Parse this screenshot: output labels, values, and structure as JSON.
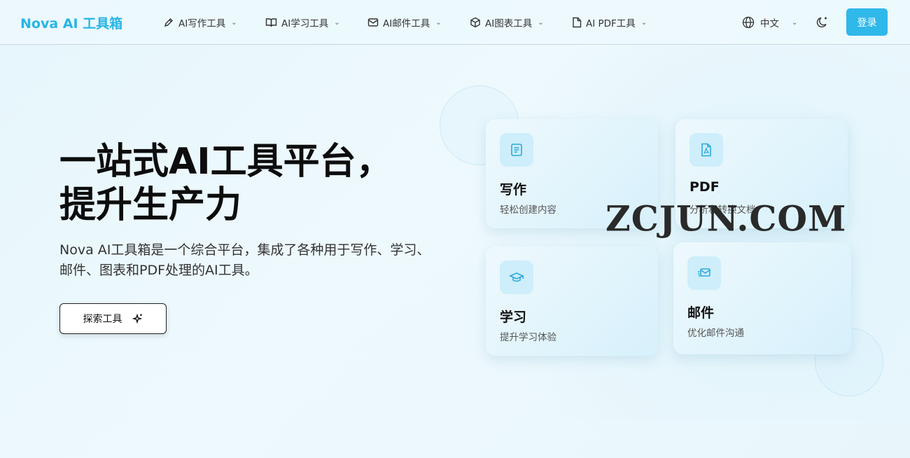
{
  "header": {
    "logo": "Nova AI 工具箱",
    "nav": [
      {
        "label": "AI写作工具",
        "icon": "pen-icon"
      },
      {
        "label": "AI学习工具",
        "icon": "book-icon"
      },
      {
        "label": "AI邮件工具",
        "icon": "mail-icon"
      },
      {
        "label": "AI图表工具",
        "icon": "cube-icon"
      },
      {
        "label": "AI PDF工具",
        "icon": "file-icon"
      }
    ],
    "language": "中文",
    "login": "登录"
  },
  "hero": {
    "title_line1": "一站式AI工具平台，",
    "title_line2": "提升生产力",
    "description": "Nova AI工具箱是一个综合平台，集成了各种用于写作、学习、邮件、图表和PDF处理的AI工具。",
    "explore": "探索工具"
  },
  "cards": [
    {
      "title": "写作",
      "subtitle": "轻松创建内容",
      "icon": "document-icon"
    },
    {
      "title": "PDF",
      "subtitle": "分析和转换文档",
      "icon": "pdf-icon"
    },
    {
      "title": "学习",
      "subtitle": "提升学习体验",
      "icon": "graduation-cap-icon"
    },
    {
      "title": "邮件",
      "subtitle": "优化邮件沟通",
      "icon": "mail-send-icon"
    }
  ],
  "watermark": "ZCJUN.COM",
  "colors": {
    "accent": "#2fb8ea",
    "logo": "#27b5e6"
  }
}
